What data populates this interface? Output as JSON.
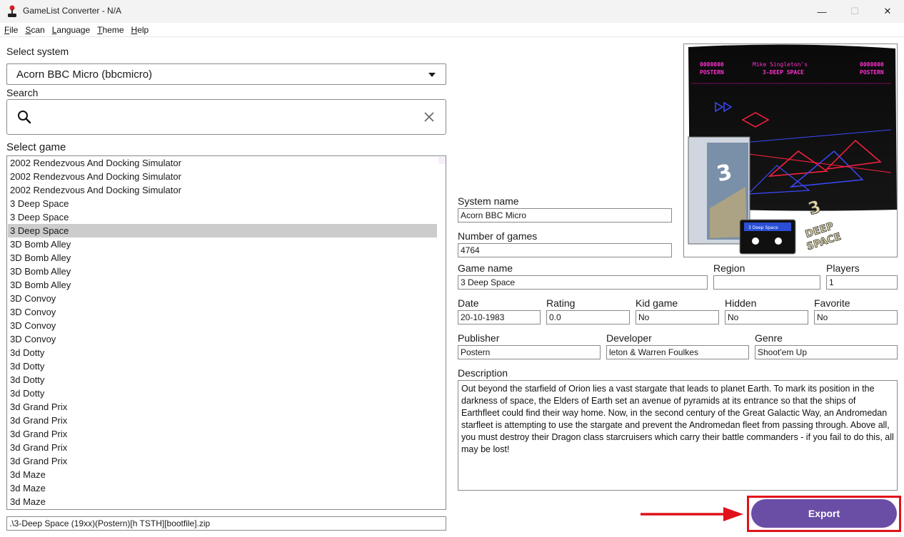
{
  "window": {
    "title": "GameList Converter - N/A",
    "controls": {
      "minimize": "—",
      "maximize": "☐",
      "close": "✕"
    }
  },
  "menu": [
    {
      "key": "F",
      "rest": "ile"
    },
    {
      "key": "S",
      "rest": "can"
    },
    {
      "key": "L",
      "rest": "anguage"
    },
    {
      "key": "T",
      "rest": "heme"
    },
    {
      "key": "H",
      "rest": "elp"
    }
  ],
  "labels": {
    "select_system": "Select system",
    "search": "Search",
    "select_game": "Select game",
    "system_name": "System name",
    "number_of_games": "Number of games",
    "game_name": "Game name",
    "region": "Region",
    "players": "Players",
    "date": "Date",
    "rating": "Rating",
    "kid_game": "Kid game",
    "hidden": "Hidden",
    "favorite": "Favorite",
    "publisher": "Publisher",
    "developer": "Developer",
    "genre": "Genre",
    "description": "Description"
  },
  "system_select": {
    "value": "Acorn BBC Micro (bbcmicro)"
  },
  "search": {
    "value": "",
    "placeholder": ""
  },
  "games": [
    "2002 Rendezvous And Docking Simulator",
    "2002 Rendezvous And Docking Simulator",
    "2002 Rendezvous And Docking Simulator",
    "3 Deep Space",
    "3 Deep Space",
    "3 Deep Space",
    "3D Bomb Alley",
    "3D Bomb Alley",
    "3D Bomb Alley",
    "3D Bomb Alley",
    "3D Convoy",
    "3D Convoy",
    "3D Convoy",
    "3D Convoy",
    "3d Dotty",
    "3d Dotty",
    "3d Dotty",
    "3d Dotty",
    "3d Grand Prix",
    "3d Grand Prix",
    "3d Grand Prix",
    "3d Grand Prix",
    "3d Grand Prix",
    "3d Maze",
    "3d Maze",
    "3d Maze"
  ],
  "selected_index": 5,
  "file_path": ".\\3-Deep Space (19xx)(Postern)[h TSTH][bootfile].zip",
  "fields": {
    "system_name": "Acorn BBC Micro",
    "number_of_games": "4764",
    "game_name": "3 Deep Space",
    "region": "",
    "players": "1",
    "date": "20-10-1983",
    "rating": "0.0",
    "kid_game": "No",
    "hidden": "No",
    "favorite": "No",
    "publisher": "Postern",
    "developer": "leton & Warren Foulkes",
    "genre": "Shoot'em Up"
  },
  "description": "Out beyond the starfield of Orion lies a vast stargate that leads to planet Earth. To mark its position in the darkness of space, the Elders of Earth set an avenue of pyramids at its entrance so that the ships of Earthfleet could find their way home. Now, in the second century of the Great Galactic Way, an Andromedan starfleet is attempting to use the stargate and prevent the Andromedan fleet from passing through. Above all, you must destroy their Dragon class starcruisers which carry their battle commanders - if you fail to do this, all may be lost!",
  "cover": {
    "score_left": "0000000",
    "score_right": "0000000",
    "header_left": "POSTERN",
    "header_right": "POSTERN",
    "credit": "Mike Singleton",
    "credit_suffix": "'s",
    "game_title": "3-DEEP SPACE",
    "cassette_label": "3 Deep Space"
  },
  "export": {
    "label": "Export"
  },
  "colors": {
    "accent": "#6a4ea6",
    "highlight": "#e0121a",
    "selection": "#cccccc"
  }
}
